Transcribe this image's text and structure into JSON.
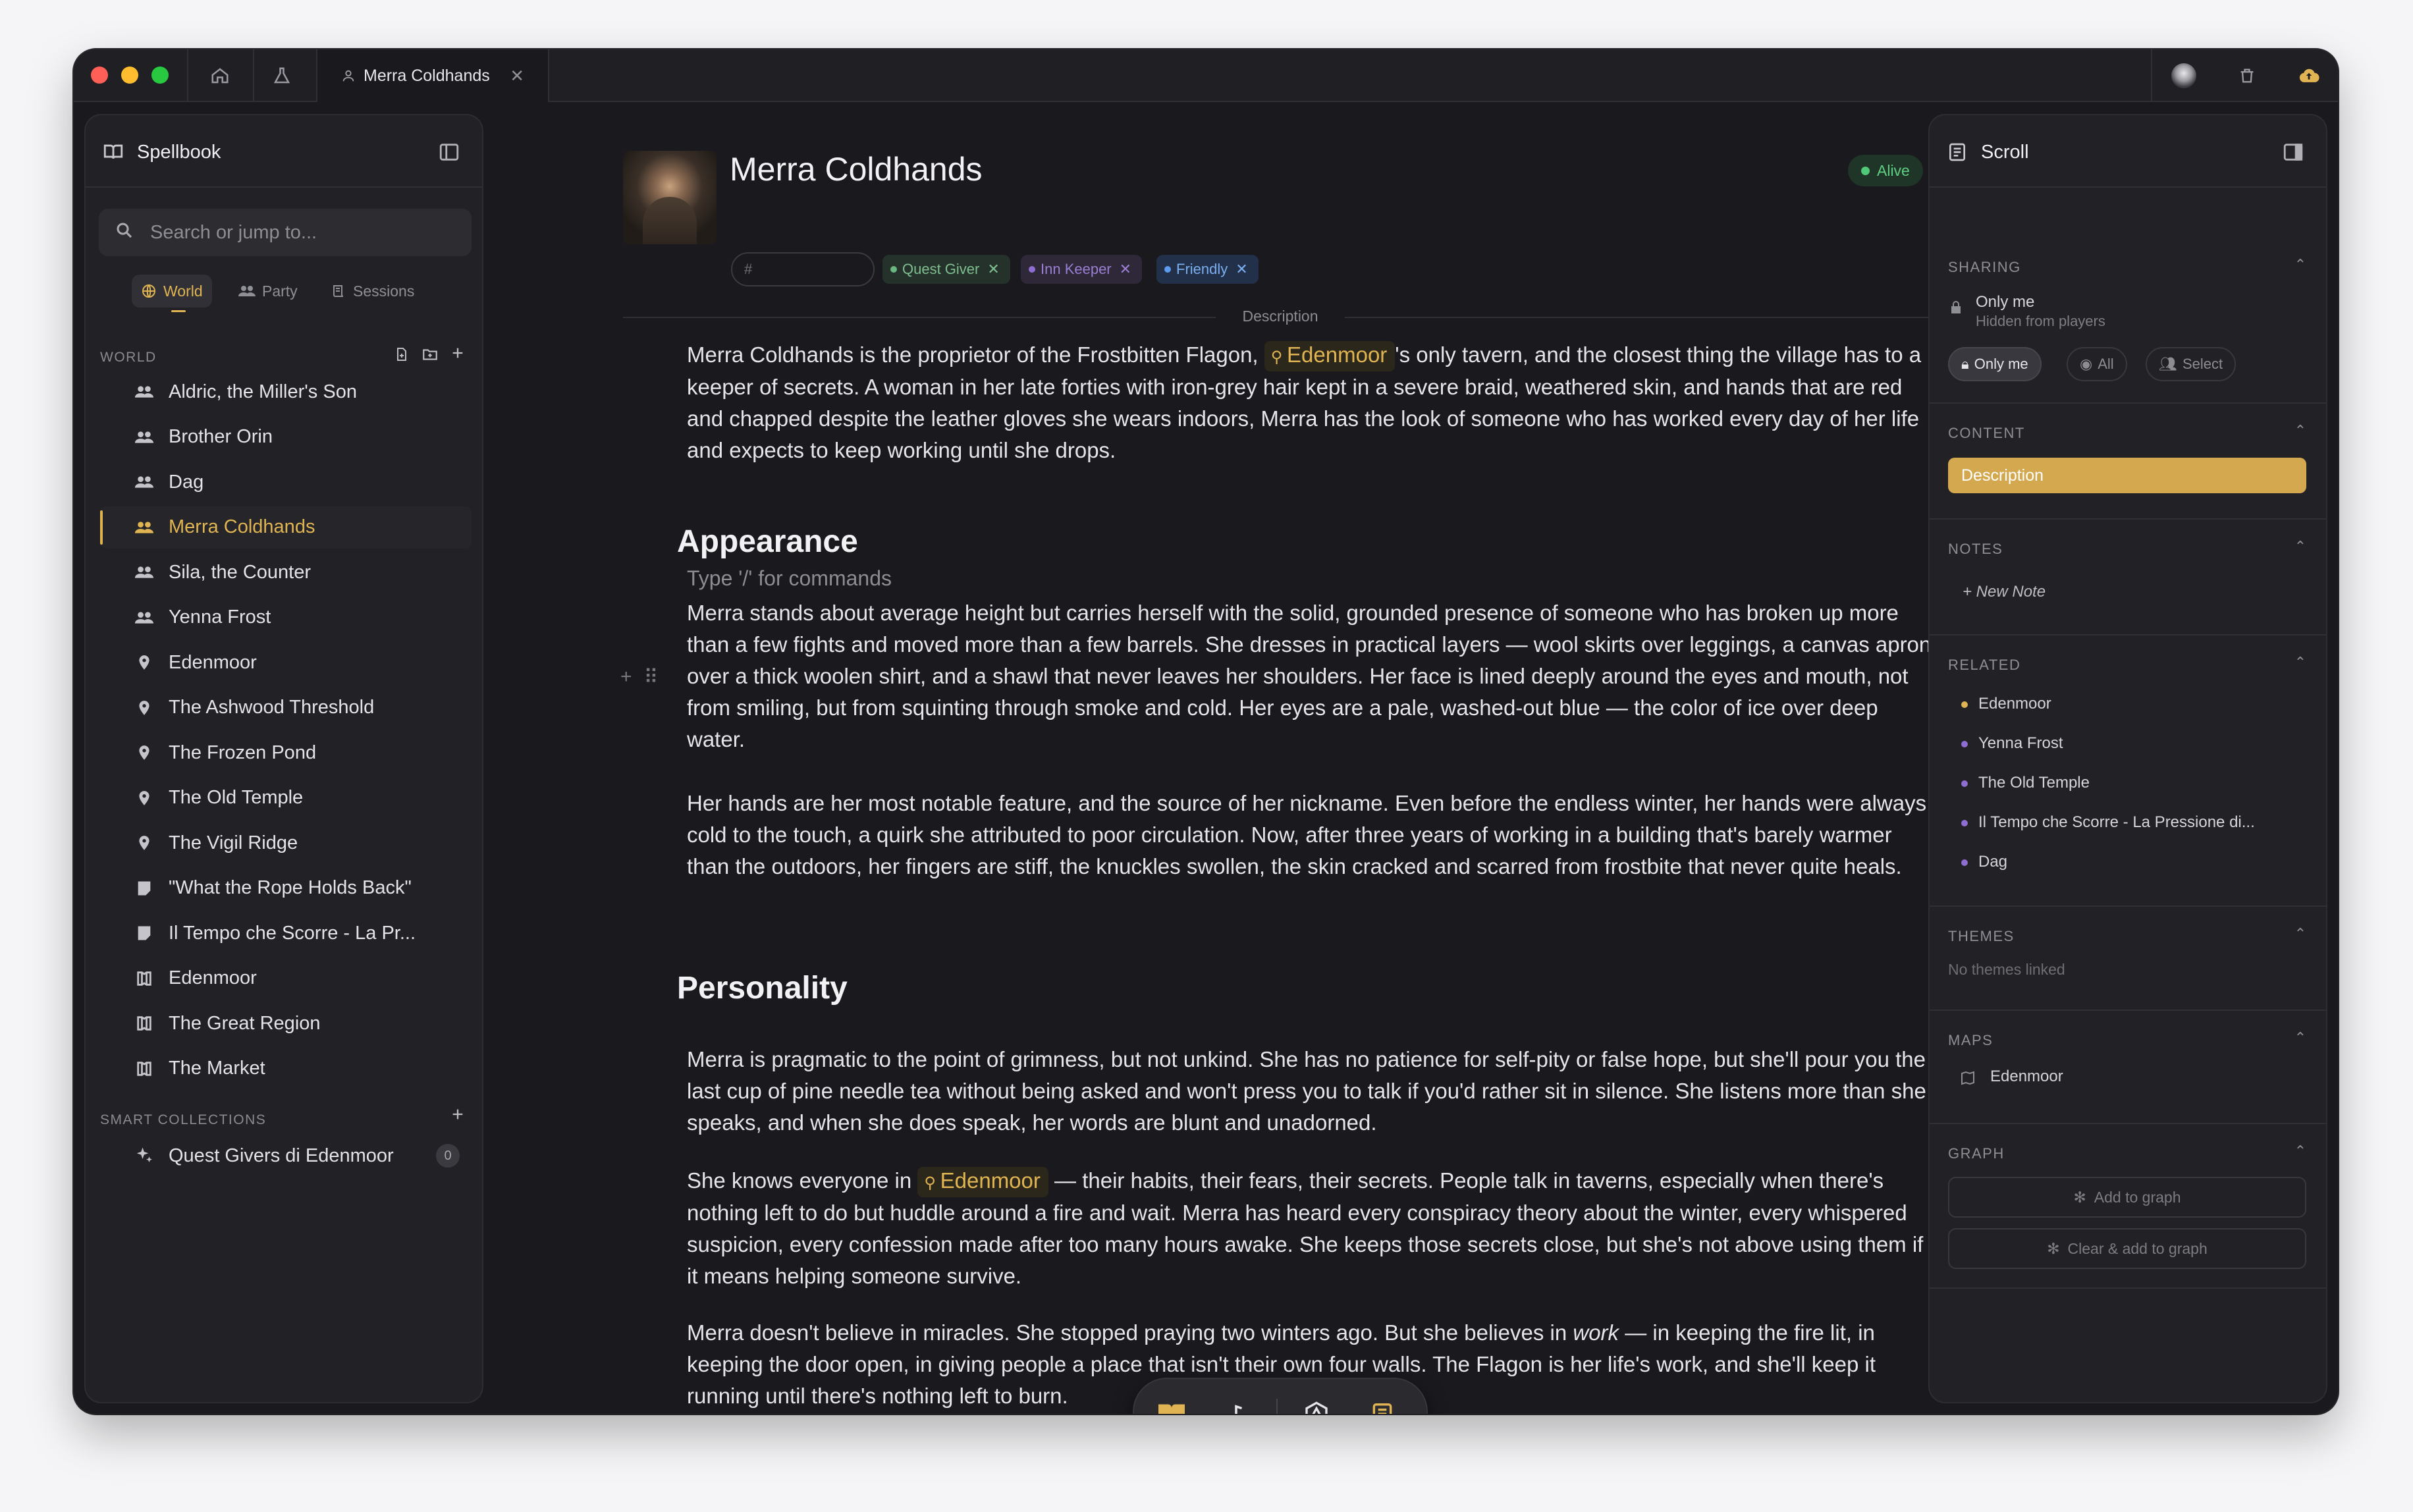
{
  "titlebar": {
    "tab_title": "Merra Coldhands",
    "tab_close": "✕"
  },
  "sidebar": {
    "title": "Spellbook",
    "search_placeholder": "Search or jump to...",
    "segments": [
      "World",
      "Party",
      "Sessions"
    ],
    "world_section": "WORLD",
    "items": [
      {
        "label": "Aldric, the Miller's Son",
        "icon": "people-icon"
      },
      {
        "label": "Brother Orin",
        "icon": "people-icon"
      },
      {
        "label": "Dag",
        "icon": "people-icon"
      },
      {
        "label": "Merra Coldhands",
        "icon": "people-icon",
        "selected": true
      },
      {
        "label": "Sila, the Counter",
        "icon": "people-icon"
      },
      {
        "label": "Yenna Frost",
        "icon": "people-icon"
      },
      {
        "label": "Edenmoor",
        "icon": "location-pin-icon"
      },
      {
        "label": "The Ashwood Threshold",
        "icon": "location-pin-icon"
      },
      {
        "label": "The Frozen Pond",
        "icon": "location-pin-icon"
      },
      {
        "label": "The Old Temple",
        "icon": "location-pin-icon"
      },
      {
        "label": "The Vigil Ridge",
        "icon": "location-pin-icon"
      },
      {
        "label": "\"What the Rope Holds Back\"",
        "icon": "note-icon"
      },
      {
        "label": "Il Tempo che Scorre - La Pr...",
        "icon": "note-icon"
      },
      {
        "label": "Edenmoor",
        "icon": "map-icon"
      },
      {
        "label": "The Great Region",
        "icon": "map-icon"
      },
      {
        "label": "The Market",
        "icon": "map-icon"
      }
    ],
    "smart_section": "SMART COLLECTIONS",
    "smart_items": [
      {
        "label": "Quest Givers di Edenmoor",
        "count": "0"
      }
    ]
  },
  "main": {
    "title": "Merra Coldhands",
    "status": "Alive",
    "tag_placeholder": "#",
    "tags": [
      "Quest Giver",
      "Inn Keeper",
      "Friendly"
    ],
    "description_label": "Description",
    "intro_a": "Merra Coldhands is the proprietor of the Frostbitten Flagon, ",
    "intro_loc": "Edenmoor",
    "intro_b": "'s only tavern, and the closest thing the village has to a keeper of secrets. A woman in her late forties with iron-grey hair kept in a severe braid, weathered skin, and hands that are red and chapped despite the leather gloves she wears indoors, Merra has the look of someone who has worked every day of her life and expects to keep working until she drops.",
    "appearance_heading": "Appearance",
    "command_hint": "Type '/' for commands",
    "appearance_p1": "Merra stands about average height but carries herself with the solid, grounded presence of someone who has broken up more than a few fights and moved more than a few barrels. She dresses in practical layers — wool skirts over leggings, a canvas apron over a thick woolen shirt, and a shawl that never leaves her shoulders. Her face is lined deeply around the eyes and mouth, not from smiling, but from squinting through smoke and cold. Her eyes are a pale, washed-out blue — the color of ice over deep water.",
    "appearance_p2": "Her hands are her most notable feature, and the source of her nickname. Even before the endless winter, her hands were always cold to the touch, a quirk she attributed to poor circulation. Now, after three years of working in a building that's barely warmer than the outdoors, her fingers are stiff, the knuckles swollen, the skin cracked and scarred from frostbite that never quite heals.",
    "personality_heading": "Personality",
    "personality_p1": "Merra is pragmatic to the point of grimness, but not unkind. She has no patience for self-pity or false hope, but she'll pour you the last cup of pine needle tea without being asked and won't press you to talk if you'd rather sit in silence. She listens more than she speaks, and when she does speak, her words are blunt and unadorned.",
    "personality_p2_a": "She knows everyone in ",
    "personality_p2_loc": "Edenmoor",
    "personality_p2_b": " — their habits, their fears, their secrets. People talk in taverns, especially when there's nothing left to do but huddle around a fire and wait. Merra has heard every conspiracy theory about the winter, every whispered suspicion, every confession made after too many hours awake. She keeps those secrets close, but she's not above using them if it means helping someone survive.",
    "personality_p3_a": "Merra doesn't believe in miracles. She stopped praying two winters ago. But she believes in ",
    "personality_p3_em": "work",
    "personality_p3_b": " — in keeping the fire lit, in keeping the door open, in giving people a place that isn't their own four walls. The Flagon is her life's work, and she'll keep it running until there's nothing left to burn."
  },
  "scroll": {
    "title": "Scroll",
    "sharing_label": "SHARING",
    "sharing_value": "Only me",
    "sharing_sub": "Hidden from players",
    "sharing_options": [
      "Only me",
      "All",
      "Select"
    ],
    "content_label": "CONTENT",
    "content_item": "Description",
    "notes_label": "NOTES",
    "new_note": "+ New Note",
    "related_label": "RELATED",
    "related": [
      "Edenmoor",
      "Yenna Frost",
      "The Old Temple",
      "Il Tempo che Scorre - La Pressione di...",
      "Dag"
    ],
    "themes_label": "THEMES",
    "themes_empty": "No themes linked",
    "maps_label": "MAPS",
    "maps": [
      "Edenmoor"
    ],
    "graph_label": "GRAPH",
    "add_graph": "Add to graph",
    "clear_graph": "Clear & add to graph"
  },
  "colors": {
    "accent": "#e0b452",
    "background": "#1a1a1e",
    "panel": "#222226",
    "alive": "#4fc877"
  }
}
